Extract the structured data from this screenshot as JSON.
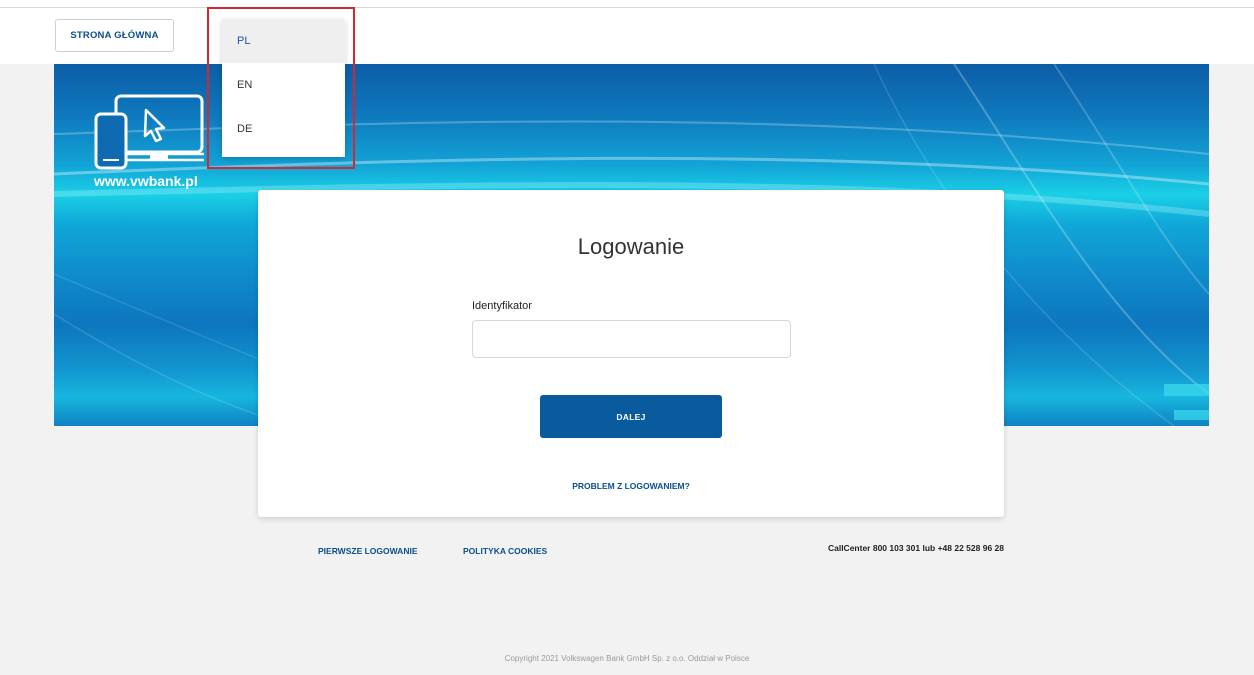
{
  "nav": {
    "home_label": "STRONA GŁÓWNA"
  },
  "language_menu": {
    "items": [
      {
        "label": "PL",
        "selected": true
      },
      {
        "label": "EN",
        "selected": false
      },
      {
        "label": "DE",
        "selected": false
      }
    ],
    "highlight_color": "#d6262e"
  },
  "hero": {
    "logo_text": "www.vwbank.pl"
  },
  "login": {
    "title": "Logowanie",
    "id_label": "Identyfikator",
    "id_value": "",
    "id_placeholder": "",
    "next_label": "DALEJ",
    "problem_link": "PROBLEM Z LOGOWANIEM?"
  },
  "footer": {
    "first_login": "PIERWSZE LOGOWANIE",
    "cookies": "POLITYKA COOKIES",
    "callcenter": "CallCenter 800 103 301 lub +48 22 528 96 28",
    "copyright": "Copyright 2021 Volkswagen Bank GmbH Sp. z o.o. Oddział w Polsce"
  },
  "colors": {
    "primary": "#0a5a9e",
    "link": "#0a4f8e",
    "page_bg": "#f2f2f2"
  }
}
